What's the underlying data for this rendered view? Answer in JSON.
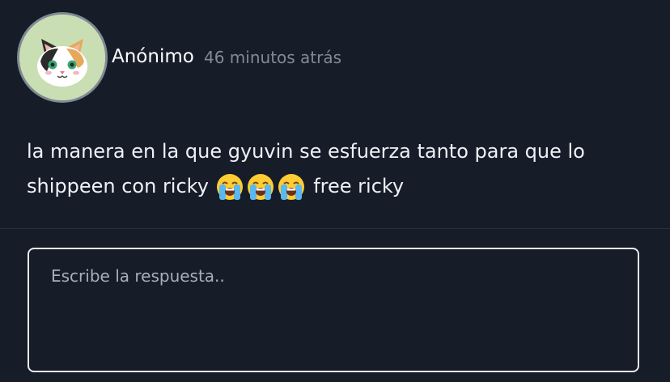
{
  "post": {
    "author": "Anónimo",
    "time": "46 minutos atrás",
    "avatar_icon": "cat-face-icon",
    "message_line1": "la manera en la que gyuvin se esfuerza tanto para que lo",
    "message_line2_prefix": "shippeen con ricky",
    "emoji": [
      "loudly-crying-face-emoji",
      "loudly-crying-face-emoji",
      "loudly-crying-face-emoji"
    ],
    "message_line2_suffix": "free ricky"
  },
  "reply": {
    "placeholder": "Escribe la respuesta.."
  },
  "colors": {
    "background": "#161d29",
    "text": "#eef1f5",
    "muted": "#818a96",
    "border": "#e8eaee"
  }
}
